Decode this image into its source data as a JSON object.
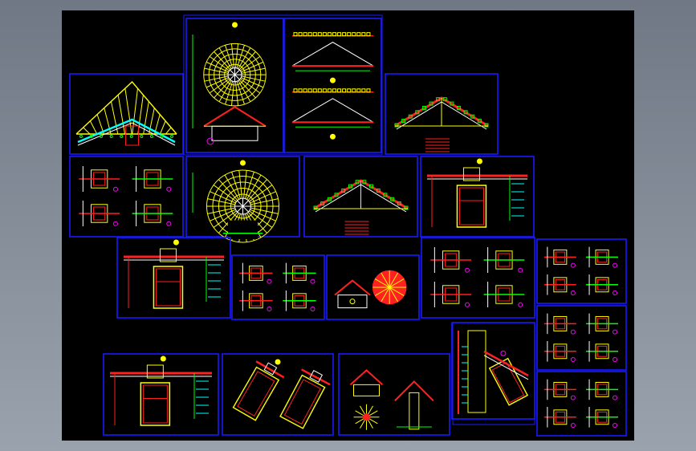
{
  "viewer": {
    "background": "#000000",
    "sheet_border_color": "#1a1aff",
    "palette": {
      "yellow": "#ffff00",
      "red": "#ff2020",
      "green": "#00ff00",
      "cyan": "#00ffff",
      "white": "#ffffff",
      "magenta": "#ff00ff"
    }
  },
  "sheets": [
    {
      "id": "truss-elevation-large",
      "kind": "truss"
    },
    {
      "id": "dome-plan-top",
      "kind": "dome"
    },
    {
      "id": "roof-sections-double",
      "kind": "roof-sections"
    },
    {
      "id": "roof-section-right",
      "kind": "roof"
    },
    {
      "id": "joint-details-left",
      "kind": "details"
    },
    {
      "id": "dome-plan-middle",
      "kind": "dome"
    },
    {
      "id": "roof-section-middle",
      "kind": "roof"
    },
    {
      "id": "column-section-middle",
      "kind": "column"
    },
    {
      "id": "beam-column-detail",
      "kind": "column"
    },
    {
      "id": "connection-detail-small",
      "kind": "details"
    },
    {
      "id": "rosette-detail",
      "kind": "rosette"
    },
    {
      "id": "multi-joint-details",
      "kind": "details"
    },
    {
      "id": "right-detail-top",
      "kind": "details"
    },
    {
      "id": "right-detail-middle",
      "kind": "details"
    },
    {
      "id": "right-detail-bottom",
      "kind": "details"
    },
    {
      "id": "bottom-column-detail",
      "kind": "column"
    },
    {
      "id": "bottom-rotated-columns",
      "kind": "rotated"
    },
    {
      "id": "bottom-roof-details",
      "kind": "roof-details"
    },
    {
      "id": "sloped-column-detail",
      "kind": "sloped"
    }
  ]
}
